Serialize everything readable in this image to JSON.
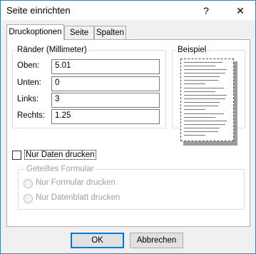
{
  "window": {
    "title": "Seite einrichten",
    "help_glyph": "?",
    "close_glyph": "✕"
  },
  "tabs": [
    {
      "label": "Druckoptionen",
      "active": true
    },
    {
      "label": "Seite",
      "active": false
    },
    {
      "label": "Spalten",
      "active": false
    }
  ],
  "margins": {
    "group_label": "Ränder (Millimeter)",
    "fields": [
      {
        "label": "Oben:",
        "value": "5.01"
      },
      {
        "label": "Unten:",
        "value": "0"
      },
      {
        "label": "Links:",
        "value": "3"
      },
      {
        "label": "Rechts:",
        "value": "1.25"
      }
    ]
  },
  "preview": {
    "group_label": "Beispiel"
  },
  "print_data_only": {
    "label": "Nur Daten drucken",
    "checked": false
  },
  "split_form": {
    "group_label": "Geteiltes Formular",
    "options": [
      {
        "label": "Nur Formular drucken",
        "enabled": false
      },
      {
        "label": "Nur Datenblatt drucken",
        "enabled": false
      }
    ]
  },
  "buttons": {
    "ok": "OK",
    "cancel": "Abbrechen"
  }
}
